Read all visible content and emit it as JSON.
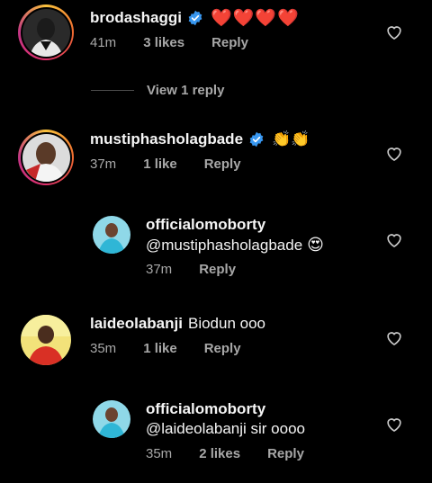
{
  "comments": [
    {
      "username": "brodashaggi",
      "verified": true,
      "text": "❤️❤️❤️❤️",
      "time": "41m",
      "likes": "3 likes",
      "reply": "Reply"
    },
    {
      "view_replies": "View 1 reply"
    },
    {
      "username": "mustiphasholagbade",
      "verified": true,
      "text": "👏👏",
      "time": "37m",
      "likes": "1 like",
      "reply": "Reply"
    },
    {
      "username": "officialomoborty",
      "text": "@mustiphasholagbade",
      "emoji": "😍",
      "time": "37m",
      "reply": "Reply"
    },
    {
      "username": "laideolabanji",
      "text": "Biodun ooo",
      "time": "35m",
      "likes": "1 like",
      "reply": "Reply"
    },
    {
      "username": "officialomoborty",
      "text": "@laideolabanji sir oooo",
      "time": "35m",
      "likes": "2 likes",
      "reply": "Reply"
    }
  ],
  "colors": {
    "background": "#000000",
    "text": "#f5f5f5",
    "muted": "#a8a8a8",
    "verified": "#3897f0"
  }
}
